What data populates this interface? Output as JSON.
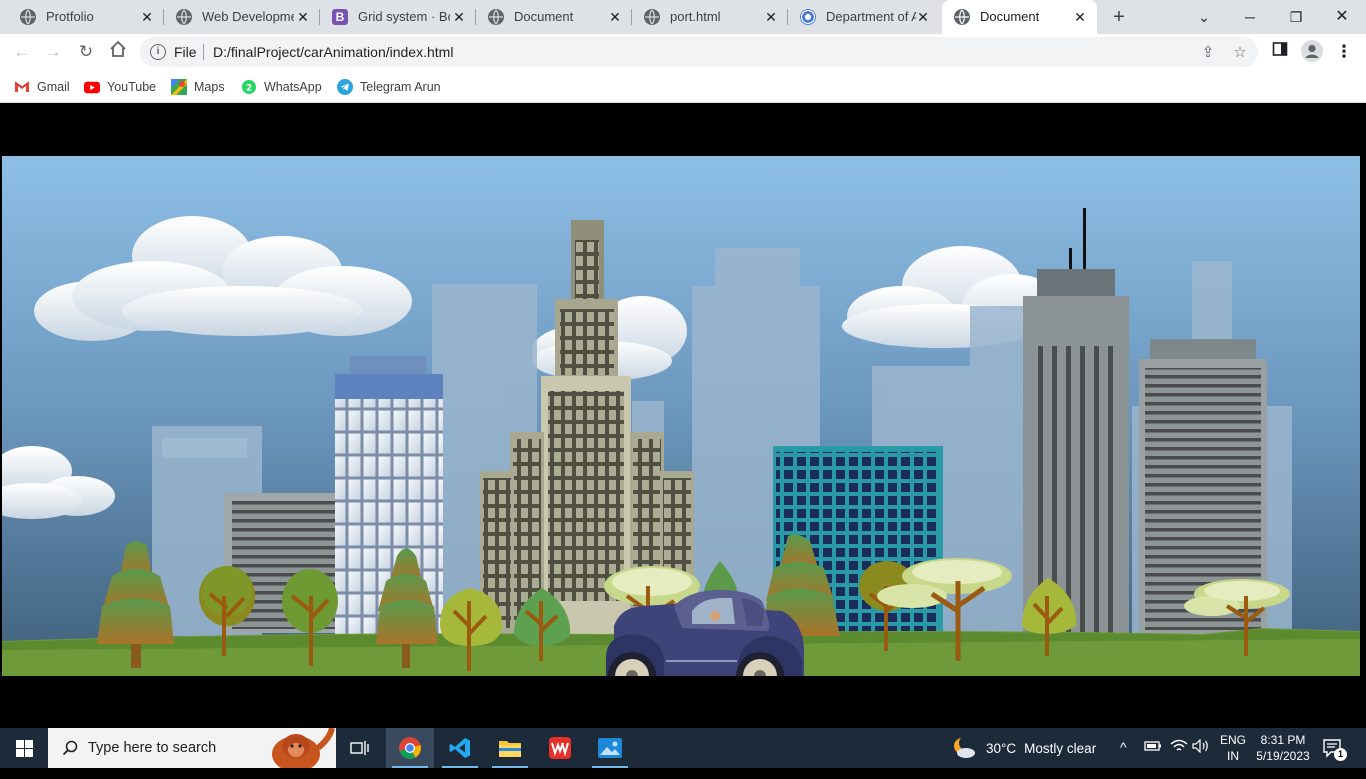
{
  "browser": {
    "tabs": [
      {
        "title": "Protfolio",
        "icon": "globe-icon",
        "active": false
      },
      {
        "title": "Web Development",
        "icon": "globe-icon",
        "active": false
      },
      {
        "title": "Grid system · Bootstrap",
        "icon": "bootstrap-icon",
        "active": false
      },
      {
        "title": "Document",
        "icon": "globe-icon",
        "active": false
      },
      {
        "title": "port.html",
        "icon": "globe-icon",
        "active": false
      },
      {
        "title": "Department of Ar",
        "icon": "department-icon",
        "active": false
      },
      {
        "title": "Document",
        "icon": "globe-icon",
        "active": true
      }
    ],
    "address": {
      "scheme": "File",
      "url": "D:/finalProject/carAnimation/index.html"
    },
    "bookmarks": [
      {
        "label": "Gmail",
        "icon": "gmail-icon"
      },
      {
        "label": "YouTube",
        "icon": "youtube-icon"
      },
      {
        "label": "Maps",
        "icon": "maps-icon"
      },
      {
        "label": "WhatsApp",
        "icon": "whatsapp-icon"
      },
      {
        "label": "Telegram Arun",
        "icon": "telegram-icon"
      }
    ],
    "bootstrap_letter": "B"
  },
  "page": {
    "scene": "city skyline with trees and a vintage car driving on the grass",
    "colors": {
      "sky_top": "#8ebfe6",
      "sky_bottom": "#4a6f8c",
      "grass": "#6f9a3a",
      "car": "#3e447a"
    }
  },
  "taskbar": {
    "search_placeholder": "Type here to search",
    "apps": [
      "file-explorer-icon",
      "chrome-icon",
      "vscode-icon",
      "explorer-icon",
      "wps-icon",
      "photos-icon"
    ],
    "weather": {
      "temp": "30°C",
      "condition": "Mostly clear"
    },
    "language": {
      "line1": "ENG",
      "line2": "IN"
    },
    "clock": {
      "time": "8:31 PM",
      "date": "5/19/2023"
    },
    "notifications": "1"
  }
}
